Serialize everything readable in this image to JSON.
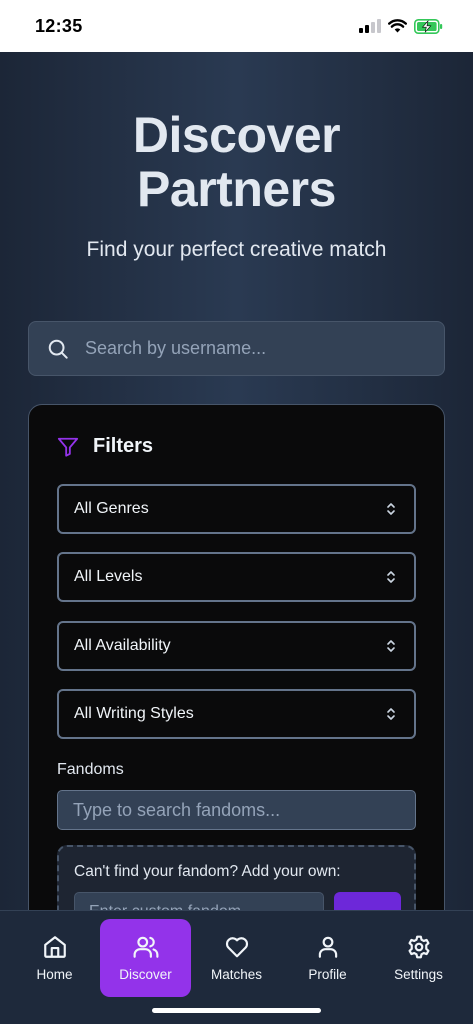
{
  "status_bar": {
    "time": "12:35"
  },
  "page": {
    "title_line1": "Discover",
    "title_line2": "Partners",
    "subtitle": "Find your perfect creative match"
  },
  "search": {
    "placeholder": "Search by username...",
    "icon": "search-icon"
  },
  "filters": {
    "title": "Filters",
    "icon": "filter-icon",
    "accent": "#9333ea",
    "selects": [
      {
        "label": "All Genres"
      },
      {
        "label": "All Levels"
      },
      {
        "label": "All Availability"
      },
      {
        "label": "All Writing Styles"
      }
    ],
    "fandoms_label": "Fandoms",
    "fandoms_placeholder": "Type to search fandoms...",
    "custom_title": "Can't find your fandom? Add your own:",
    "custom_placeholder": "Enter custom fandom..."
  },
  "nav": {
    "items": [
      {
        "label": "Home",
        "icon": "home-icon"
      },
      {
        "label": "Discover",
        "icon": "users-icon",
        "active": true
      },
      {
        "label": "Matches",
        "icon": "heart-icon"
      },
      {
        "label": "Profile",
        "icon": "user-icon"
      },
      {
        "label": "Settings",
        "icon": "gear-icon"
      }
    ]
  }
}
